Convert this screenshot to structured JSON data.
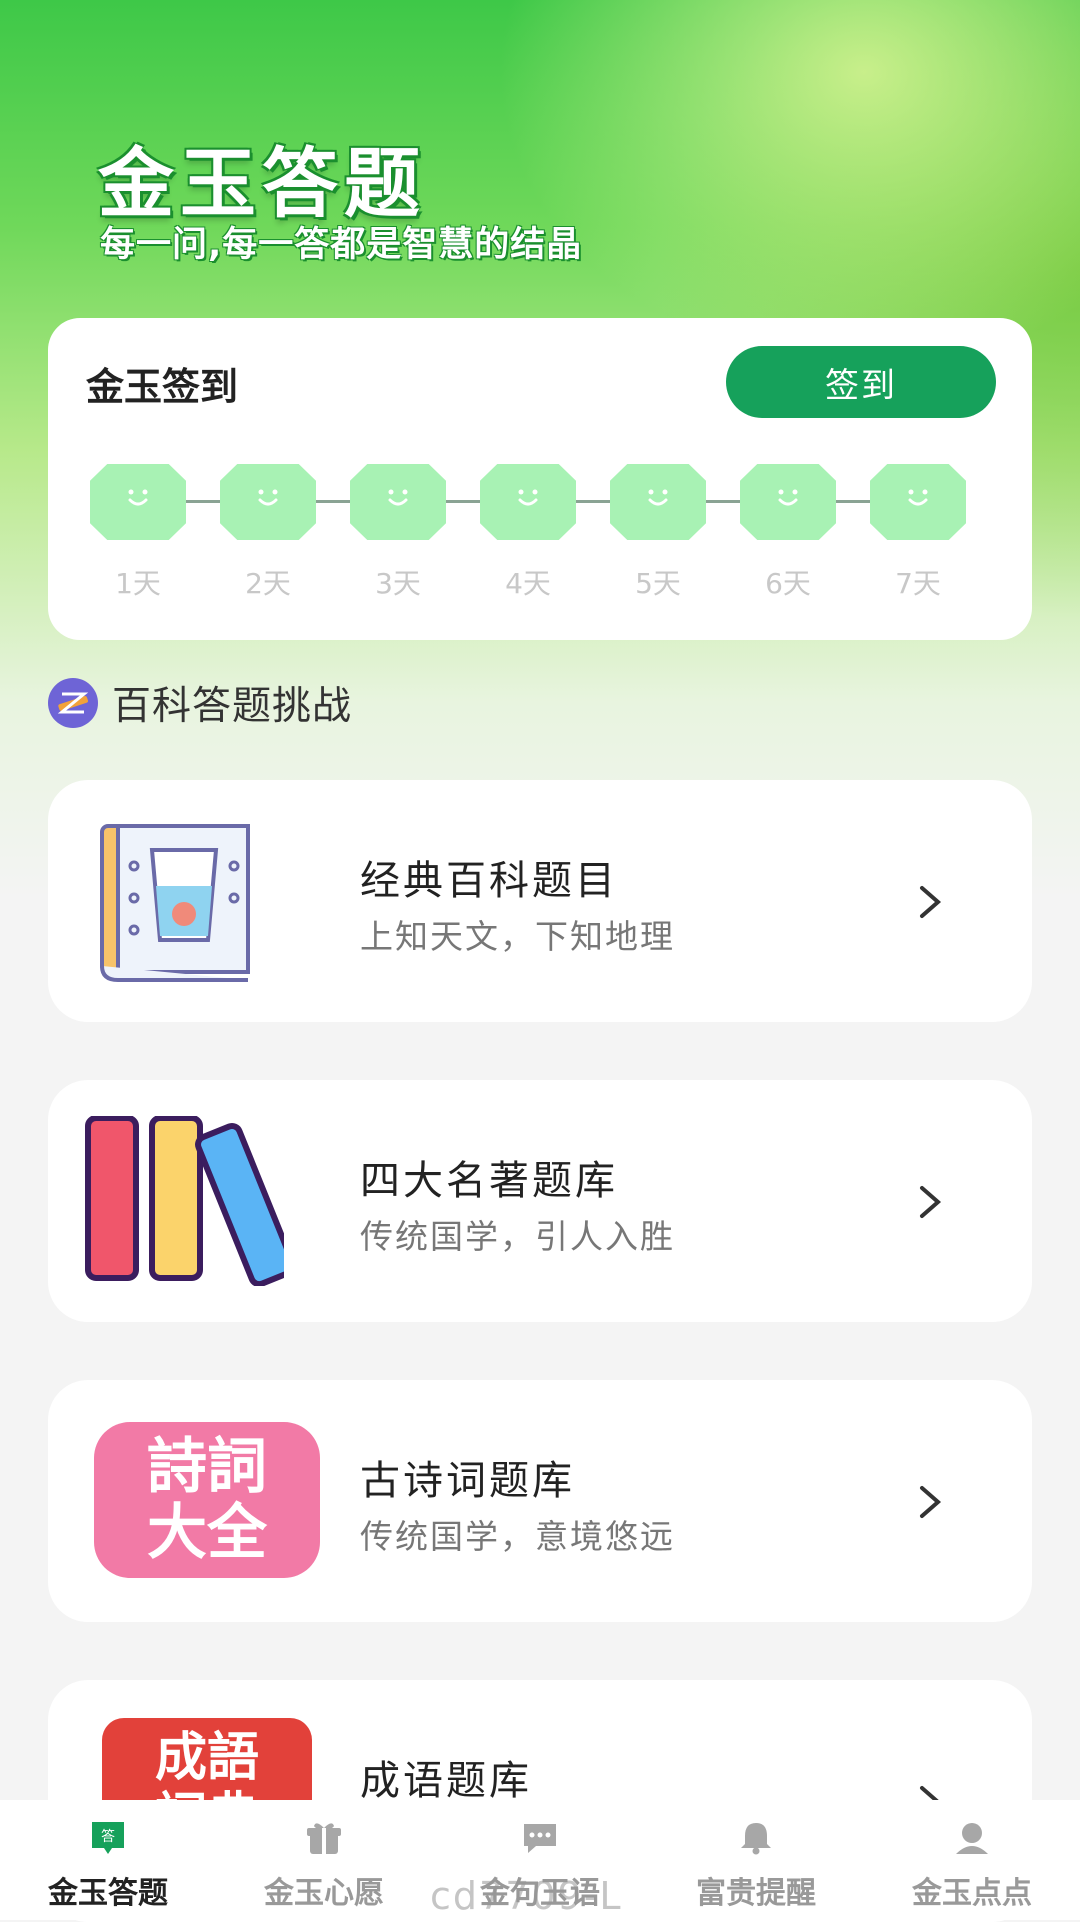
{
  "app": {
    "title": "金玉答题",
    "subtitle": "每一问,每一答都是智慧的结晶"
  },
  "checkin": {
    "title": "金玉签到",
    "button_label": "签到",
    "days": [
      "1天",
      "2天",
      "3天",
      "4天",
      "5天",
      "6天",
      "7天"
    ]
  },
  "section": {
    "title": "百科答题挑战",
    "icon": "pencil-badge-icon"
  },
  "quizzes": [
    {
      "title": "经典百科题目",
      "desc": "上知天文，下知地理",
      "icon": "book-icon"
    },
    {
      "title": "四大名著题库",
      "desc": "传统国学，引人入胜",
      "icon": "books-icon"
    },
    {
      "title": "古诗词题库",
      "desc": "传统国学，意境悠远",
      "icon": "poetry-icon",
      "thumb_text": [
        "詩詞",
        "大全"
      ]
    },
    {
      "title": "成语题库",
      "desc": "",
      "icon": "idiom-icon",
      "thumb_text": [
        "成語",
        "詞典"
      ]
    }
  ],
  "tabs": [
    {
      "label": "金玉答题",
      "icon": "answer-icon",
      "active": true
    },
    {
      "label": "金玉心愿",
      "icon": "gift-icon",
      "active": false
    },
    {
      "label": "金句玉语",
      "icon": "chat-icon",
      "active": false
    },
    {
      "label": "富贵提醒",
      "icon": "bell-icon",
      "active": false
    },
    {
      "label": "金玉点点",
      "icon": "profile-icon",
      "active": false
    }
  ],
  "build_tag": "cd7709-L",
  "colors": {
    "accent": "#16a15b",
    "badge": "#a8f2b4"
  }
}
